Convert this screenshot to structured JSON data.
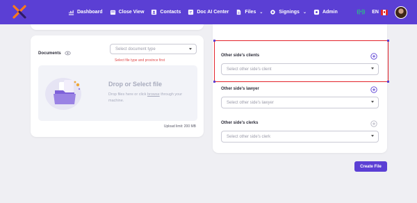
{
  "nav": {
    "items": [
      {
        "label": "Dashboard",
        "icon": "chart-icon"
      },
      {
        "label": "Close View",
        "icon": "calendar-icon"
      },
      {
        "label": "Contacts",
        "icon": "contact-card-icon"
      },
      {
        "label": "Doc AI Center",
        "icon": "document-icon"
      },
      {
        "label": "Files",
        "icon": "file-icon",
        "dropdown": true
      },
      {
        "label": "Signings",
        "icon": "gear-icon",
        "dropdown": true
      },
      {
        "label": "Admin",
        "icon": "shield-icon"
      }
    ],
    "signal": "((•))",
    "language": "EN",
    "brand_color": "#5b3fd4"
  },
  "documents": {
    "label": "Documents",
    "select_placeholder": "Select document type",
    "error": "Select file type and province first",
    "dropzone_title": "Drop or Select file",
    "dropzone_sub_before": "Drop files here or click",
    "dropzone_browse": "browse",
    "dropzone_sub_after": "through your machine.",
    "upload_limit": "Upload limit: 200 MB"
  },
  "other_side": {
    "clients_label": "Other side's clients",
    "clients_placeholder": "Select other side's client",
    "lawyer_label": "Other side's lawyer",
    "lawyer_placeholder": "Select other side's lawyer",
    "clerks_label": "Other side's clerks",
    "clerks_placeholder": "Select other side's clerk"
  },
  "actions": {
    "create_file": "Create File"
  }
}
